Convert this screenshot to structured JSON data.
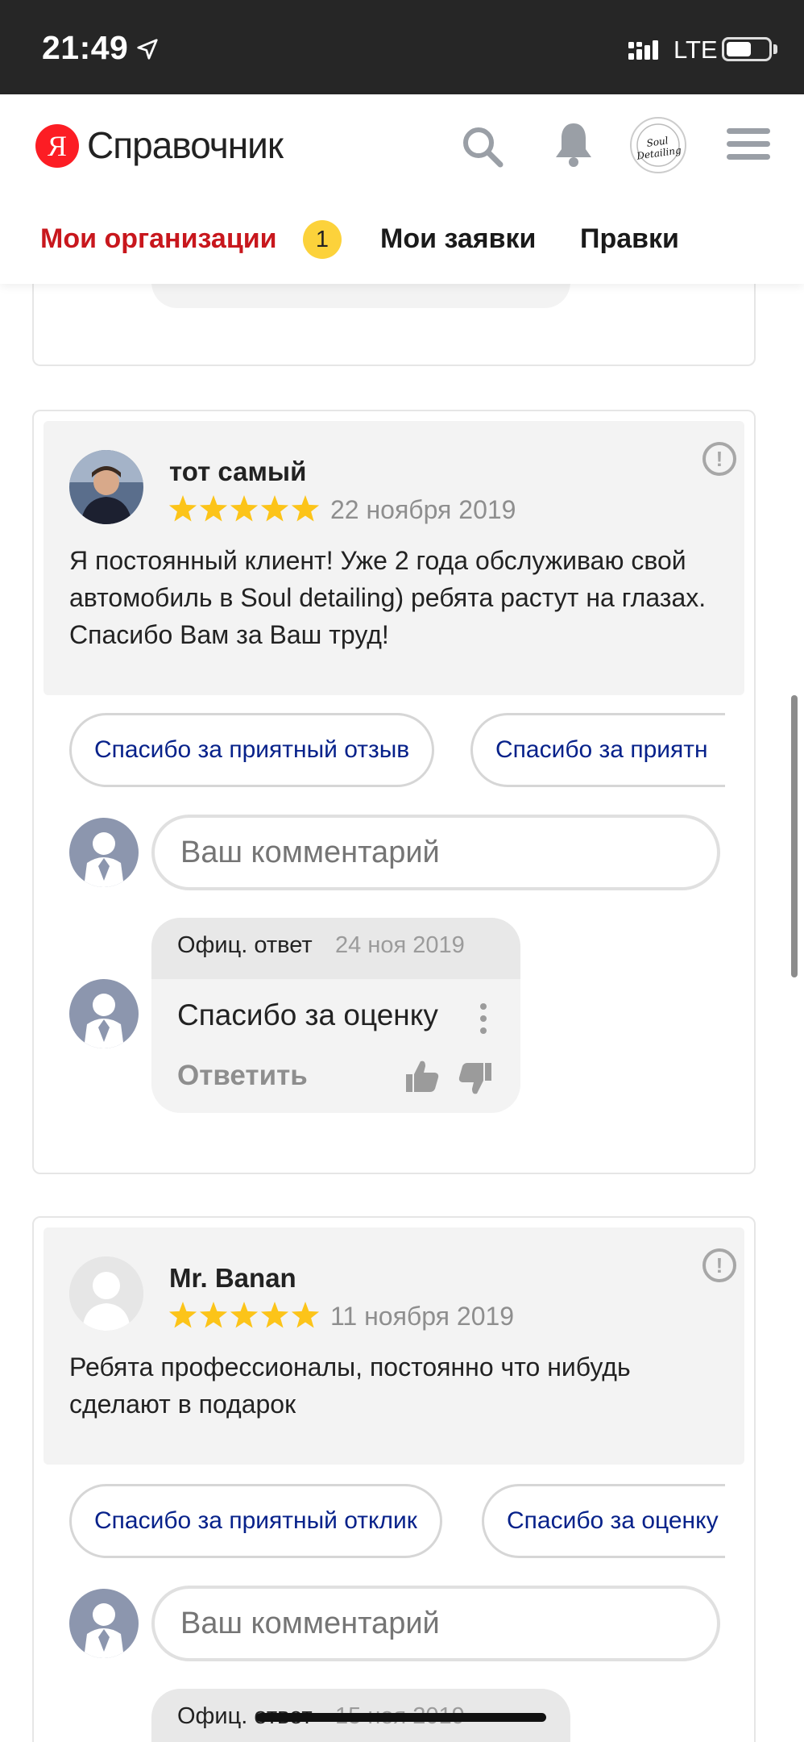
{
  "status_bar": {
    "time": "21:49",
    "network": "LTE",
    "battery_level": 0.6
  },
  "header": {
    "logo_letter": "Я",
    "logo_text": "Справочник",
    "avatar_text": "Soul Detailing",
    "tabs": [
      {
        "label": "Мои организации",
        "badge": "1",
        "active": true
      },
      {
        "label": "Мои заявки"
      },
      {
        "label": "Правки"
      }
    ]
  },
  "reviews": [
    {
      "author": "тот самый",
      "rating": 5,
      "date": "22 ноября 2019",
      "text": "Я постоянный клиент! Уже 2 года обслуживаю свой автомобиль в Soul detailing) ребята растут на глазах. Спасибо Вам за Ваш труд!",
      "quick_replies": [
        "Спасибо за приятный отзыв",
        "Спасибо за приятн"
      ],
      "comment_placeholder": "Ваш комментарий",
      "official_reply": {
        "title": "Офиц. ответ",
        "date": "24 ноя 2019",
        "text": "Спасибо за оценку",
        "answer_label": "Ответить"
      }
    },
    {
      "author": "Mr. Banan",
      "rating": 5,
      "date": "11 ноября 2019",
      "text": "Ребята профессионалы, постоянно что нибудь сделают в подарок",
      "quick_replies": [
        "Спасибо за приятный отклик",
        "Спасибо за оценку"
      ],
      "comment_placeholder": "Ваш комментарий",
      "official_reply": {
        "title": "Офиц. ответ",
        "date": "15 ноя 2019"
      }
    }
  ],
  "colors": {
    "brand_red": "#fc1d24",
    "active_tab": "#c8171d",
    "badge_yellow": "#fcd23b",
    "star_yellow": "#fcc419",
    "link_blue": "#06218a"
  }
}
